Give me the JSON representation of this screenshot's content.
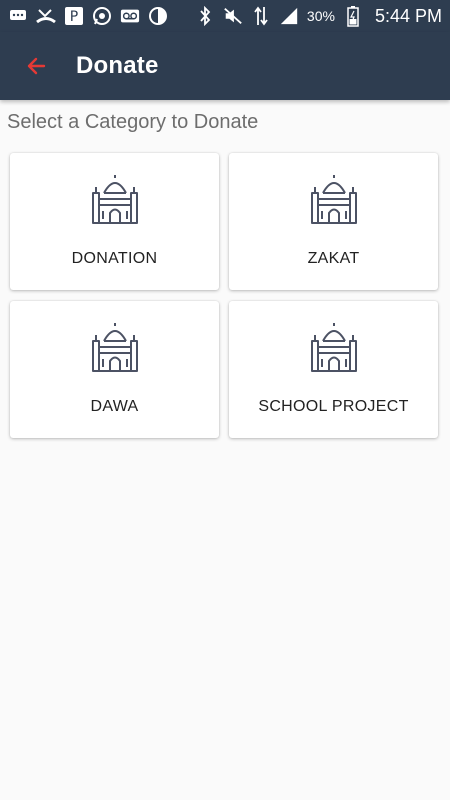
{
  "status_bar": {
    "battery_percent": "30%",
    "time": "5:44 PM",
    "left_icons": [
      "message-icon",
      "missed-call-icon",
      "parking-icon",
      "whatsapp-icon",
      "voicemail-icon",
      "half-moon-icon"
    ],
    "right_icons": [
      "bluetooth-icon",
      "mute-icon",
      "data-arrows-icon",
      "signal-icon",
      "battery-icon"
    ]
  },
  "app_bar": {
    "title": "Donate",
    "back_icon": "arrow-left-icon",
    "background": "#2e3d50",
    "accent": "#e53935"
  },
  "main": {
    "section_label": "Select a Category to Donate",
    "categories": [
      {
        "label": "DONATION",
        "icon": "mosque-icon"
      },
      {
        "label": "ZAKAT",
        "icon": "mosque-icon"
      },
      {
        "label": "DAWA",
        "icon": "mosque-icon"
      },
      {
        "label": "SCHOOL PROJECT",
        "icon": "mosque-icon"
      }
    ]
  }
}
